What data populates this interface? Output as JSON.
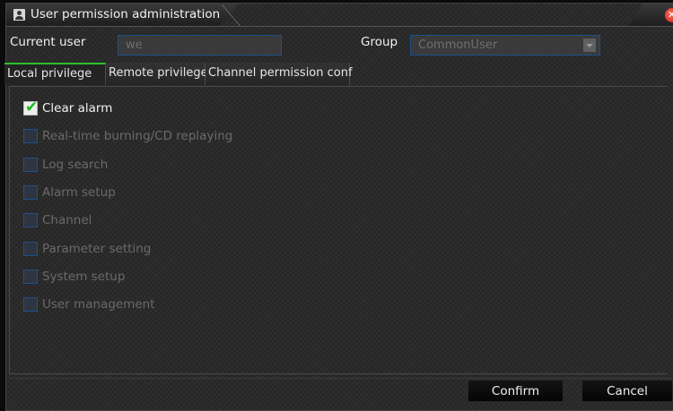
{
  "window": {
    "title": "User permission administration"
  },
  "form": {
    "current_user_label": "Current user",
    "current_user_value": "we",
    "group_label": "Group",
    "group_value": "CommonUser"
  },
  "tabs": [
    {
      "label": "Local privilege",
      "active": true
    },
    {
      "label": "Remote privilege",
      "active": false
    },
    {
      "label": "Channel permission conf",
      "active": false
    }
  ],
  "permissions": [
    {
      "label": "Clear alarm",
      "checked": true,
      "enabled": true
    },
    {
      "label": "Real-time burning/CD replaying",
      "checked": false,
      "enabled": false
    },
    {
      "label": "Log search",
      "checked": false,
      "enabled": false
    },
    {
      "label": "Alarm setup",
      "checked": false,
      "enabled": false
    },
    {
      "label": "Channel",
      "checked": false,
      "enabled": false
    },
    {
      "label": "Parameter setting",
      "checked": false,
      "enabled": false
    },
    {
      "label": "System setup",
      "checked": false,
      "enabled": false
    },
    {
      "label": "User management",
      "checked": false,
      "enabled": false
    }
  ],
  "buttons": {
    "confirm": "Confirm",
    "cancel": "Cancel"
  },
  "colors": {
    "active_tab_accent": "#2bc02b",
    "field_border": "#20508a",
    "check_mark": "#19b81d",
    "close_button": "#d62b1c"
  },
  "icons": {
    "title": "user-icon",
    "close": "close-icon",
    "dropdown": "chevron-down-icon",
    "check": "check-icon"
  }
}
